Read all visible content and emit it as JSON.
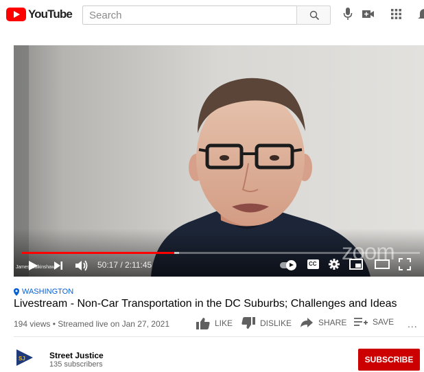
{
  "header": {
    "logo_text": "YouTube",
    "search_placeholder": "Search",
    "icons": [
      "search-icon",
      "microphone-icon",
      "create-video-icon",
      "apps-grid-icon",
      "notifications-bell-icon"
    ]
  },
  "player": {
    "watermark_name": "James Walkinshaw",
    "zoom_watermark": "zoom",
    "time_display": "50:17 / 2:11:45",
    "progress_played": 0.382,
    "progress_buffered": 0.395,
    "icons": [
      "play-icon",
      "next-icon",
      "volume-icon",
      "autoplay-toggle-icon",
      "captions-icon",
      "settings-gear-icon",
      "miniplayer-icon",
      "theater-mode-icon",
      "fullscreen-icon"
    ],
    "captions_label": "CC"
  },
  "video": {
    "location": "WASHINGTON",
    "title": "Livestream - Non-Car Transportation in the DC Suburbs; Challenges and Ideas",
    "meta": "194 views • Streamed live on Jan 27, 2021",
    "actions": {
      "like": "LIKE",
      "dislike": "DISLIKE",
      "share": "SHARE",
      "save": "SAVE",
      "more": "..."
    }
  },
  "channel": {
    "name": "Street Justice",
    "subscribers": "135 subscribers",
    "avatar_text": "SJ",
    "subscribe_label": "SUBSCRIBE"
  },
  "colors": {
    "brand_red": "#ff0000",
    "subscribe_red": "#cc0000",
    "link_blue": "#065fd4",
    "meta_gray": "#606060"
  }
}
